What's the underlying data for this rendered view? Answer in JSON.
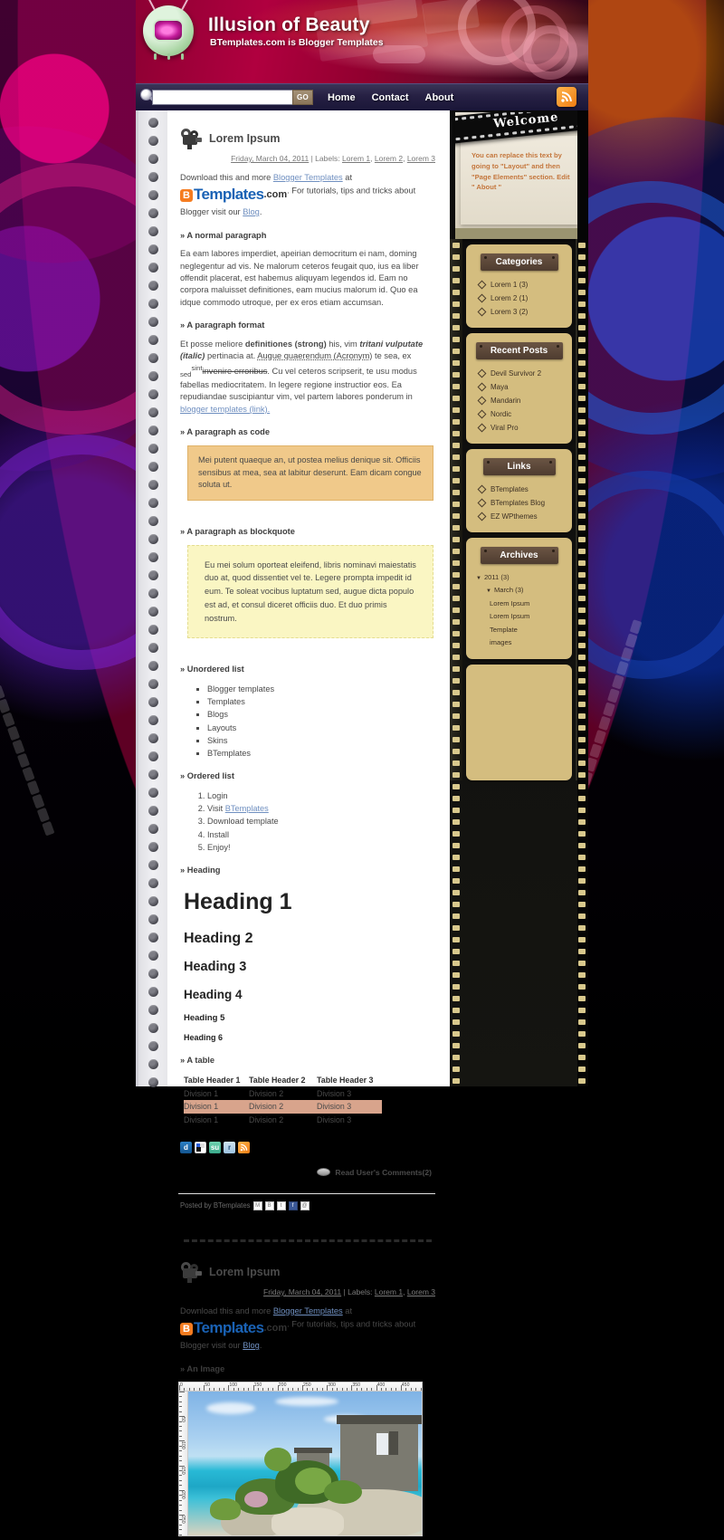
{
  "header": {
    "title": "Illusion of Beauty",
    "subtitle": "BTemplates.com is Blogger Templates",
    "logo_icon": "tv-mascot-icon"
  },
  "nav": {
    "search_placeholder": "",
    "search_value": "",
    "go_label": "GO",
    "links": [
      {
        "label": "Home"
      },
      {
        "label": "Contact"
      },
      {
        "label": "About"
      }
    ],
    "rss_icon": "rss-icon"
  },
  "posts": [
    {
      "title": "Lorem Ipsum",
      "date": "Friday, March 04, 2011",
      "meta_sep": "| Labels:",
      "labels": [
        "Lorem 1",
        "Lorem 2",
        "Lorem 3"
      ],
      "intro_pre": "Download this and more ",
      "intro_link": "Blogger Templates",
      "intro_at": " at ",
      "logo_b": "B",
      "logo_templates": "Templates",
      "logo_dotcom": ".com",
      "intro_post": ". For tutorials, tips and tricks about Blogger visit our ",
      "intro_blog_link": "Blog",
      "intro_end": ".",
      "sections": {
        "normal_heading": "» A normal paragraph",
        "normal_text": "Ea eam labores imperdiet, apeirian democritum ei nam, doming neglegentur ad vis. Ne malorum ceteros feugait quo, ius ea liber offendit placerat, est habemus aliquyam legendos id. Eam no corpora maluisset definitiones, eam mucius malorum id. Quo ea idque commodo utroque, per ex eros etiam accumsan.",
        "format_heading": "» A paragraph format",
        "format_p1": "Et posse meliore ",
        "format_strong": "definitiones (strong)",
        "format_p2": " his, vim ",
        "format_italic": "tritani vulputate (italic)",
        "format_p3": " pertinacia at. ",
        "format_acronym": "Augue quaerendum (Acronym)",
        "format_p4": " te sea, ex ",
        "format_sub": "sed",
        "format_sup": "sint",
        "format_strike": "invenire erroribus",
        "format_p5": ". Cu vel ceteros scripserit, te usu modus fabellas mediocritatem. In legere regione instructior eos. Ea repudiandae suscipiantur vim, vel partem labores ponderum in ",
        "format_link": "blogger templates (link).",
        "code_heading": "» A paragraph as code",
        "code_text": "Mei putent quaeque an, ut postea melius denique sit. Officiis sensibus at mea, sea at labitur deserunt. Eam dicam congue soluta ut.",
        "quote_heading": "» A paragraph as blockquote",
        "quote_text": "Eu mei solum oporteat eleifend, libris nominavi maiestatis duo at, quod dissentiet vel te. Legere prompta impedit id eum. Te soleat vocibus luptatum sed, augue dicta populo est ad, et consul diceret officiis duo. Et duo primis nostrum.",
        "ul_heading": "» Unordered list",
        "ul_items": [
          "Blogger templates",
          "Templates",
          "Blogs",
          "Layouts",
          "Skins",
          "BTemplates"
        ],
        "ol_heading": "» Ordered list",
        "ol_items": [
          "Login",
          "Visit BTemplates",
          "Download template",
          "Install",
          "Enjoy!"
        ],
        "ol_link_text": "BTemplates",
        "heading_heading": "» Heading",
        "h1": "Heading 1",
        "h2": "Heading 2",
        "h3": "Heading 3",
        "h4": "Heading 4",
        "h5": "Heading 5",
        "h6": "Heading 6",
        "table_heading": "» A table",
        "table_headers": [
          "Table Header 1",
          "Table Header 2",
          "Table Header 3"
        ],
        "table_rows": [
          [
            "Division 1",
            "Division 2",
            "Division 3"
          ],
          [
            "Division 1",
            "Division 2",
            "Division 3"
          ],
          [
            "Division 1",
            "Division 2",
            "Division 3"
          ]
        ],
        "table_highlight_row": 1
      },
      "share_icons": [
        "digg-icon",
        "delicious-icon",
        "stumbleupon-icon",
        "reddit-icon",
        "rss-icon"
      ],
      "comments_label": "Read User's Comments(2)",
      "comments_icon": "comment-bubble-icon",
      "posted_by": "Posted by BTemplates",
      "posted_icons": [
        "email-icon",
        "blog-this-icon",
        "twitter-icon",
        "facebook-icon",
        "pinterest-icon"
      ]
    },
    {
      "title": "Lorem Ipsum",
      "date": "Friday, March 04, 2011",
      "meta_sep": "| Labels:",
      "labels": [
        "Lorem 1",
        "Lorem 3"
      ],
      "intro_pre": "Download this and more ",
      "intro_link": "Blogger Templates",
      "intro_at": " at ",
      "logo_b": "B",
      "logo_templates": "Templates",
      "logo_dotcom": ".com",
      "intro_post": ". For tutorials, tips and tricks about Blogger visit our ",
      "intro_blog_link": "Blog",
      "intro_end": ".",
      "image_heading": "» An Image",
      "image_alt": "Mayan ruins on a cliff above turquoise sea",
      "ruler_h_labels": [
        "0",
        "50",
        "100",
        "150",
        "200",
        "250",
        "300",
        "350",
        "400",
        "450"
      ],
      "ruler_v_labels": [
        "50",
        "100",
        "150",
        "200",
        "250"
      ]
    }
  ],
  "sidebar": {
    "welcome": {
      "banner_label": "Welcome",
      "text": "You can replace this text by going to \"Layout\" and then \"Page Elements\" section. Edit \" About \""
    },
    "widgets": [
      {
        "title": "Categories",
        "items": [
          {
            "label": "Lorem 1 (3)"
          },
          {
            "label": "Lorem 2 (1)"
          },
          {
            "label": "Lorem 3 (2)"
          }
        ]
      },
      {
        "title": "Recent Posts",
        "items": [
          {
            "label": "Devil Survivor 2"
          },
          {
            "label": "Maya"
          },
          {
            "label": "Mandarin"
          },
          {
            "label": "Nordic"
          },
          {
            "label": "Viral Pro"
          }
        ]
      },
      {
        "title": "Links",
        "items": [
          {
            "label": "BTemplates"
          },
          {
            "label": "BTemplates Blog"
          },
          {
            "label": "EZ WPthemes"
          }
        ]
      }
    ],
    "archives": {
      "title": "Archives",
      "year": "2011 (3)",
      "month": "March (3)",
      "entries": [
        "Lorem Ipsum",
        "Lorem Ipsum",
        "Template images"
      ]
    }
  },
  "colors": {
    "banner_red": "#b0003f",
    "nav_navy": "#262043",
    "sidebar_gold": "#d4bd7f",
    "widget_title_brown": "#4e3c2f",
    "code_amber": "#f0c98a",
    "quote_yellow": "#faf6c3",
    "table_highlight": "#d8a48c",
    "link_blue": "#6f8fc0",
    "welcome_orange": "#c4763c"
  }
}
